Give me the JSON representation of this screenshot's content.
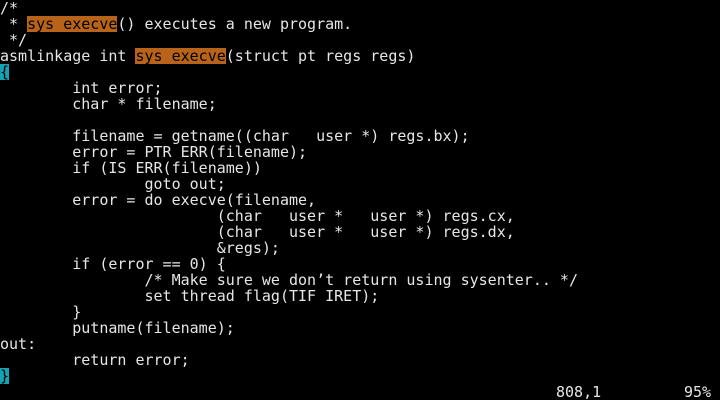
{
  "editor": {
    "lines": [
      [
        {
          "text": "/*"
        }
      ],
      [
        {
          "text": " * "
        },
        {
          "text": "sys_execve",
          "style": "hl"
        },
        {
          "text": "() executes a new program."
        }
      ],
      [
        {
          "text": " */"
        }
      ],
      [
        {
          "text": "asmlinkage int "
        },
        {
          "text": "sys_execve",
          "style": "hl"
        },
        {
          "text": "(struct pt_regs regs)"
        }
      ],
      [
        {
          "text": "{",
          "style": "cursor"
        }
      ],
      [
        {
          "text": "        int error;"
        }
      ],
      [
        {
          "text": "        char * filename;"
        }
      ],
      [
        {
          "text": ""
        }
      ],
      [
        {
          "text": "        filename = getname((char __user *) regs.bx);"
        }
      ],
      [
        {
          "text": "        error = PTR_ERR(filename);"
        }
      ],
      [
        {
          "text": "        if (IS_ERR(filename))"
        }
      ],
      [
        {
          "text": "                goto out;"
        }
      ],
      [
        {
          "text": "        error = do_execve(filename,"
        }
      ],
      [
        {
          "text": "                        (char __user * __user *) regs.cx,"
        }
      ],
      [
        {
          "text": "                        (char __user * __user *) regs.dx,"
        }
      ],
      [
        {
          "text": "                        &regs);"
        }
      ],
      [
        {
          "text": "        if (error == 0) {"
        }
      ],
      [
        {
          "text": "                /* Make sure we don’t return using sysenter.. */"
        }
      ],
      [
        {
          "text": "                set_thread_flag(TIF_IRET);"
        }
      ],
      [
        {
          "text": "        }"
        }
      ],
      [
        {
          "text": "        putname(filename);"
        }
      ],
      [
        {
          "text": "out:"
        }
      ],
      [
        {
          "text": "        return error;"
        }
      ],
      [
        {
          "text": "}",
          "style": "cursor"
        }
      ]
    ]
  },
  "status": {
    "position": "808,1",
    "percent": "95%"
  },
  "colors": {
    "background": "#000000",
    "foreground": "#e6e6e6",
    "search_highlight": "#b8631a",
    "cursor": "#13a3b3"
  }
}
